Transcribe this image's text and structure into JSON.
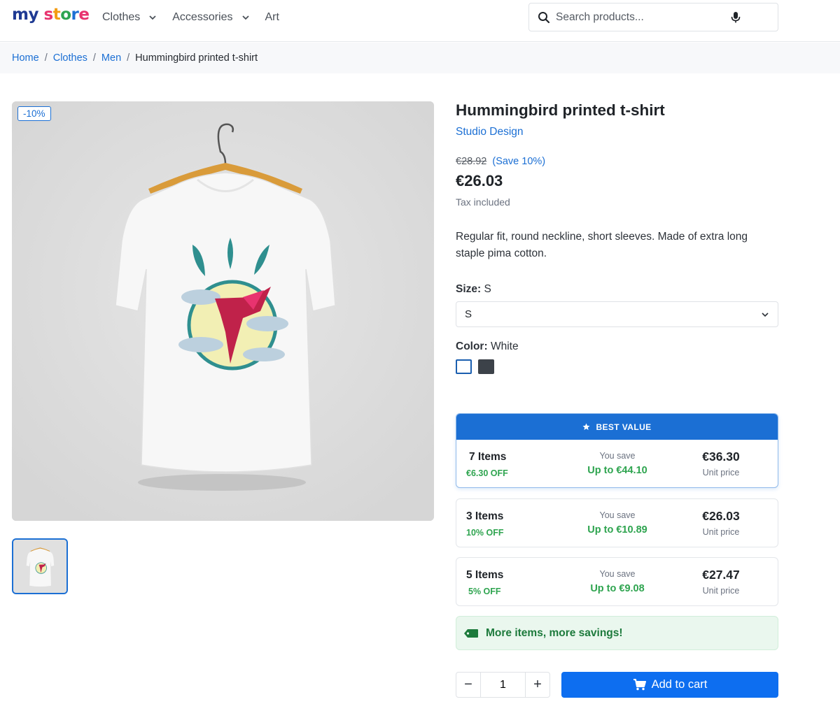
{
  "header": {
    "logo_part1": "my",
    "logo_part2": "store",
    "nav": [
      {
        "label": "Clothes",
        "has_dropdown": true
      },
      {
        "label": "Accessories",
        "has_dropdown": true
      },
      {
        "label": "Art",
        "has_dropdown": false
      }
    ],
    "search_placeholder": "Search products..."
  },
  "breadcrumb": {
    "items": [
      "Home",
      "Clothes",
      "Men"
    ],
    "separator": "/",
    "current": "Hummingbird printed t-shirt"
  },
  "product": {
    "discount_badge": "-10%",
    "title": "Hummingbird printed t-shirt",
    "brand": "Studio Design",
    "old_price": "€28.92",
    "save_pct": "(Save 10%)",
    "price": "€26.03",
    "tax_note": "Tax included",
    "description": "Regular fit, round neckline, short sleeves. Made of extra long staple pima cotton."
  },
  "options": {
    "size_label": "Size:",
    "size_value": "S",
    "size_selected": "S",
    "color_label": "Color:",
    "color_value": "White",
    "colors": [
      {
        "name": "White",
        "hex": "#ffffff",
        "selected": true
      },
      {
        "name": "Dark grey",
        "hex": "#3c4249",
        "selected": false
      }
    ]
  },
  "tiers": {
    "best_label": "BEST VALUE",
    "you_save_label": "You save",
    "unit_price_label": "Unit price",
    "items": [
      {
        "qty": "7 Items",
        "off": "€6.30 OFF",
        "save": "Up to €44.10",
        "price": "€36.30"
      },
      {
        "qty": "3 Items",
        "off": "10% OFF",
        "save": "Up to €10.89",
        "price": "€26.03"
      },
      {
        "qty": "5 Items",
        "off": "5% OFF",
        "save": "Up to €9.08",
        "price": "€27.47"
      }
    ]
  },
  "savings_banner": "More items, more savings!",
  "cart": {
    "quantity": "1",
    "minus": "−",
    "plus": "+",
    "add_label": "Add to cart"
  },
  "colors": {
    "accent": "#1b6fd4",
    "button": "#0d6ef0",
    "success": "#2ea44f"
  }
}
